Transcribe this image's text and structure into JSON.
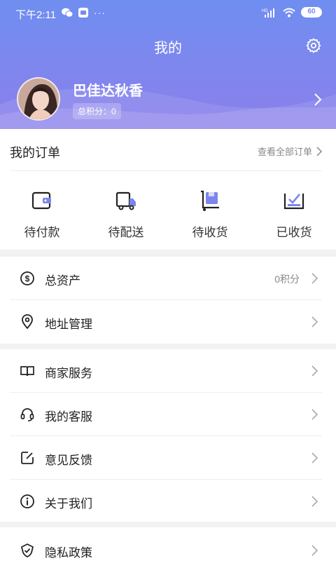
{
  "status_bar": {
    "time": "下午2:11",
    "left_icons": [
      "wechat-icon",
      "app-notification-icon",
      "more-dots-icon"
    ],
    "right_icons": [
      "hd-signal-icon",
      "wifi-icon"
    ],
    "battery": "60"
  },
  "header": {
    "title": "我的",
    "settings_icon": "gear-icon",
    "gradient_colors": [
      "#6f8ef0",
      "#8b7fea"
    ]
  },
  "profile": {
    "name": "巴佳达秋香",
    "points_label": "总积分：0"
  },
  "orders": {
    "title": "我的订单",
    "view_all": "查看全部订单",
    "items": [
      {
        "label": "待付款",
        "icon": "wallet-icon"
      },
      {
        "label": "待配送",
        "icon": "delivery-truck-icon"
      },
      {
        "label": "待收货",
        "icon": "cart-box-icon"
      },
      {
        "label": "已收货",
        "icon": "received-tray-icon"
      }
    ]
  },
  "menu_group1": [
    {
      "label": "总资产",
      "value": "0积分",
      "icon": "dollar-circle-icon"
    },
    {
      "label": "地址管理",
      "value": "",
      "icon": "location-pin-icon"
    }
  ],
  "menu_group2": [
    {
      "label": "商家服务",
      "icon": "book-icon"
    },
    {
      "label": "我的客服",
      "icon": "headset-icon"
    },
    {
      "label": "意见反馈",
      "icon": "edit-note-icon"
    },
    {
      "label": "关于我们",
      "icon": "info-circle-icon"
    }
  ],
  "menu_group3": [
    {
      "label": "隐私政策",
      "icon": "shield-check-icon"
    }
  ],
  "accent_color": "#7b86ec"
}
